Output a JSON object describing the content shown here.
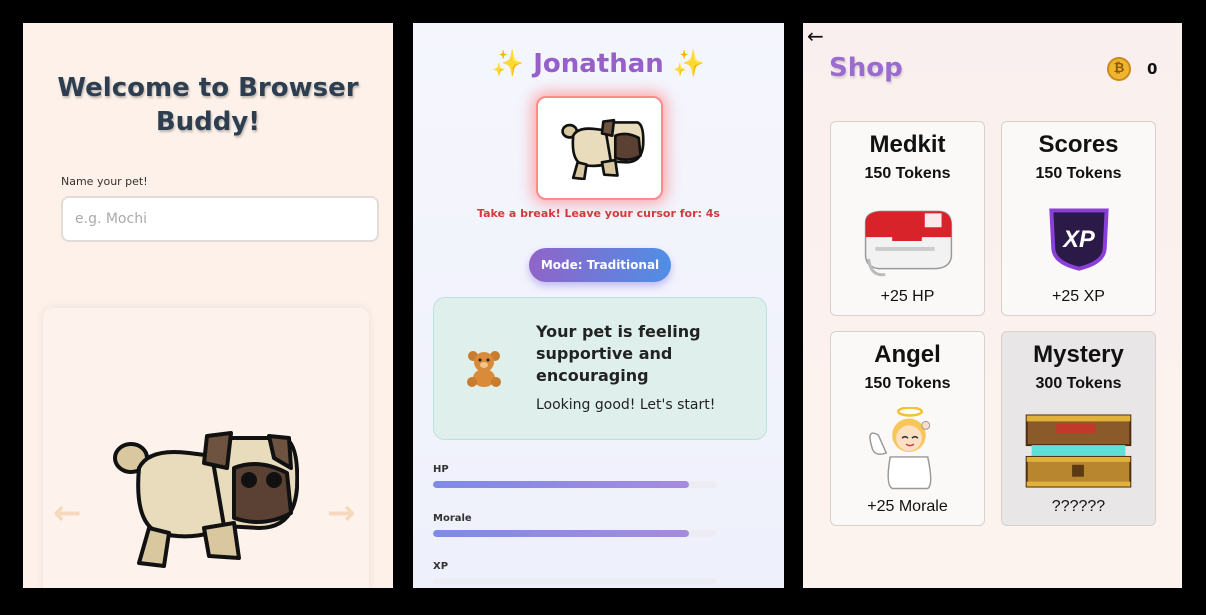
{
  "welcome": {
    "title_line1": "Welcome to Browser",
    "title_line2": "Buddy!",
    "name_label": "Name your pet!",
    "name_placeholder": "e.g. Mochi",
    "prev_arrow": "←",
    "next_arrow": "→"
  },
  "pet": {
    "name": "Jonathan",
    "sparkle": "✨",
    "warning": "Take a break! Leave your cursor for: 4s",
    "mode_label": "Mode: Traditional",
    "mood_title": "Your pet is feeling supportive and encouraging",
    "mood_message": "Looking good! Let's start!",
    "stats": [
      {
        "label": "HP",
        "level": 0.9
      },
      {
        "label": "Morale",
        "level": 0.9
      },
      {
        "label": "XP",
        "level": 0
      }
    ]
  },
  "shop": {
    "back_icon": "←",
    "title": "Shop",
    "coin_symbol": "₿",
    "coins": "0",
    "items": [
      {
        "name": "Medkit",
        "price": "150 Tokens",
        "effect": "+25 HP",
        "icon": "medkit-icon"
      },
      {
        "name": "Scores",
        "price": "150 Tokens",
        "effect": "+25 XP",
        "icon": "xp-badge-icon"
      },
      {
        "name": "Angel",
        "price": "150 Tokens",
        "effect": "+25 Morale",
        "icon": "angel-icon"
      },
      {
        "name": "Mystery",
        "price": "300 Tokens",
        "effect": "??????",
        "icon": "treasure-chest-icon"
      }
    ]
  },
  "colors": {
    "accent_purple": "#9b6ccf",
    "warning_red": "#d33a3a",
    "title_navy": "#2d3e50"
  }
}
